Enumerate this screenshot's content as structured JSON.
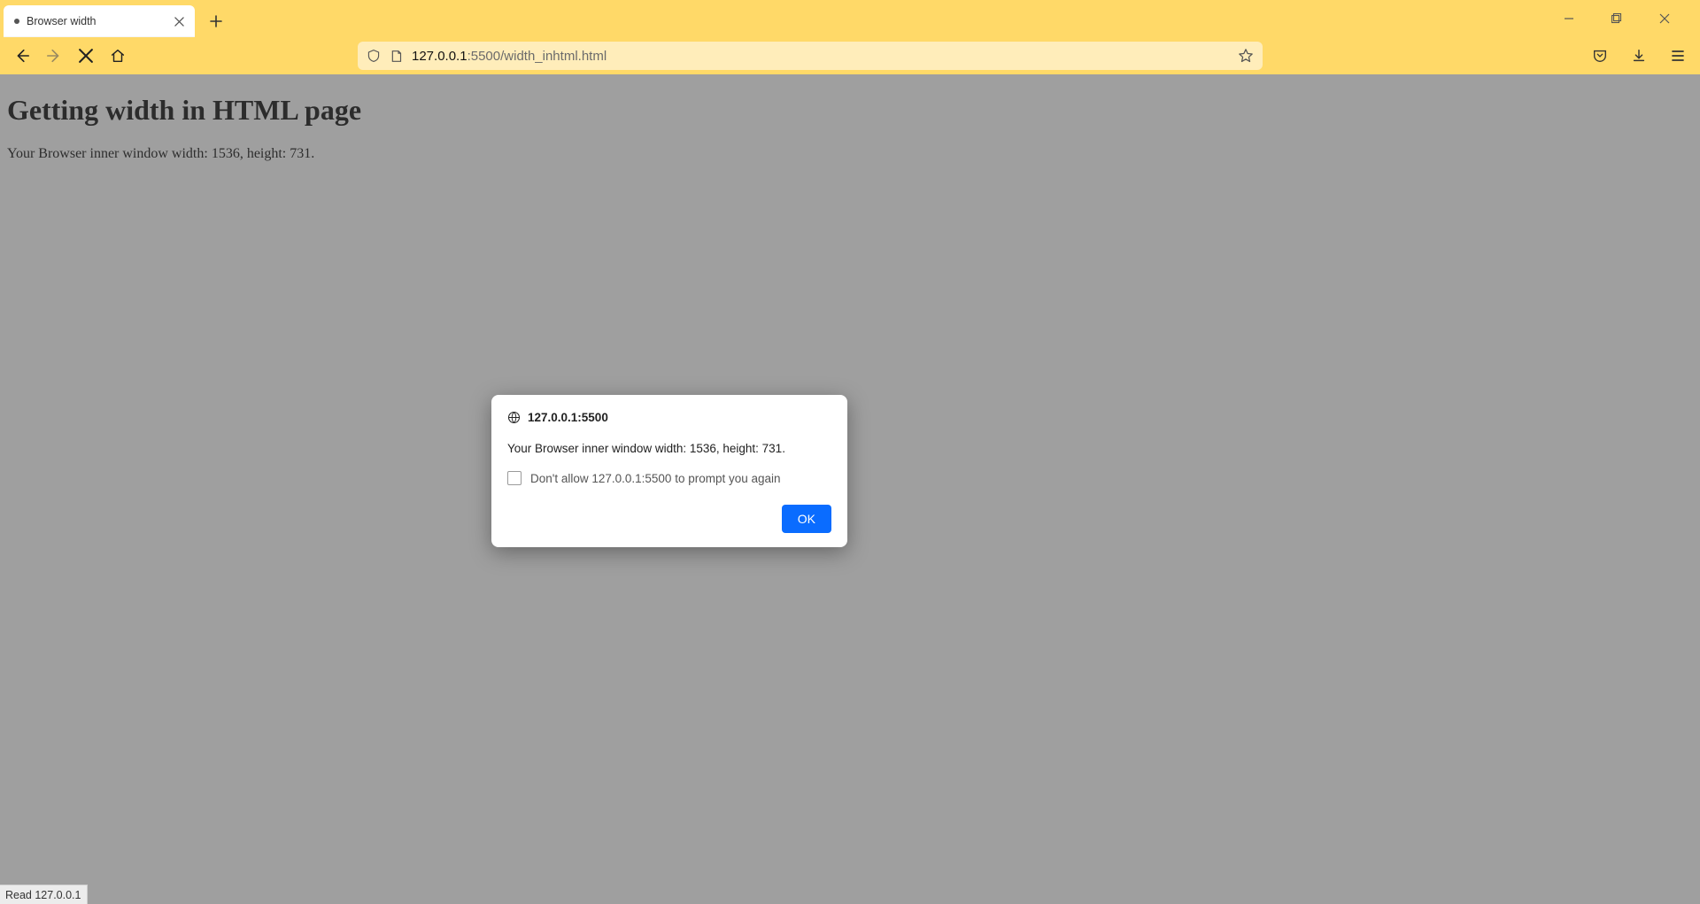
{
  "tabs": [
    {
      "title": "Browser width",
      "loading": true
    }
  ],
  "window_controls": {
    "minimize": "minimize",
    "maximize": "maximize",
    "close": "close"
  },
  "address": {
    "host": "127.0.0.1",
    "port": ":5500",
    "path": "/width_inhtml.html"
  },
  "page": {
    "heading": "Getting width in HTML page",
    "paragraph": "Your Browser inner window width: 1536, height: 731."
  },
  "dialog": {
    "origin": "127.0.0.1:5500",
    "message": "Your Browser inner window width: 1536, height: 731.",
    "suppress_label": "Don't allow 127.0.0.1:5500 to prompt you again",
    "ok_label": "OK"
  },
  "statusbar": "Read 127.0.0.1"
}
